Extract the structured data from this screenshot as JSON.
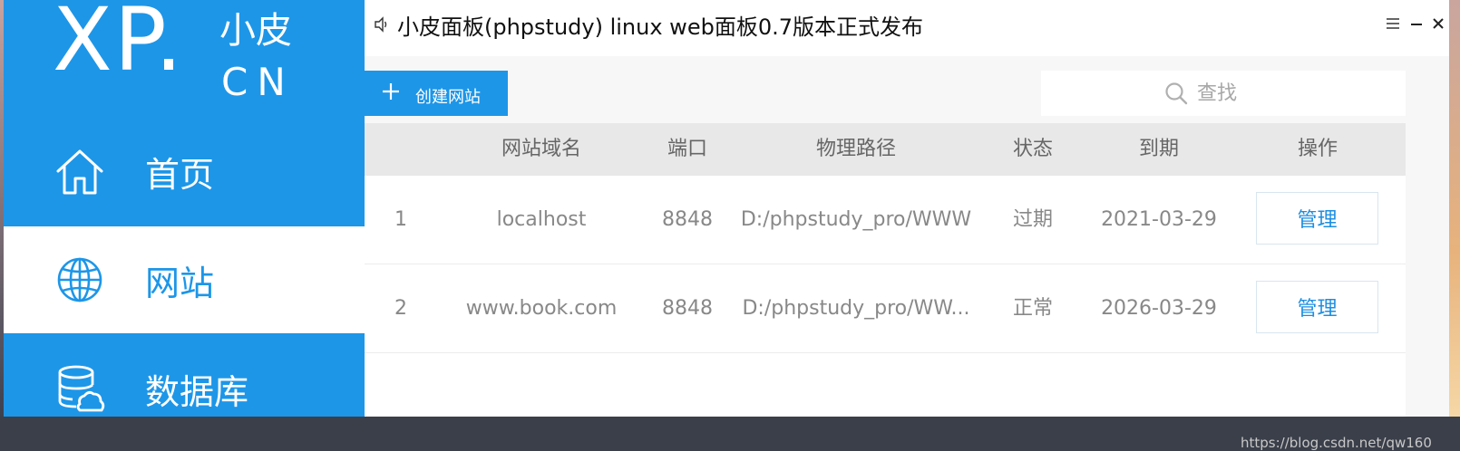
{
  "logo": {
    "mark": "XP.",
    "cn_top": "小皮",
    "cn_bottom": "CN"
  },
  "sidebar": {
    "items": [
      {
        "label": "首页",
        "icon": "home-icon",
        "active": false
      },
      {
        "label": "网站",
        "icon": "globe-icon",
        "active": true
      },
      {
        "label": "数据库",
        "icon": "database-icon",
        "active": false
      }
    ]
  },
  "window": {
    "title": "小皮面板(phpstudy) linux web面板0.7版本正式发布",
    "title_icon": "speaker-icon"
  },
  "toolbar": {
    "create_label": "创建网站",
    "search_placeholder": "查找"
  },
  "table": {
    "headers": [
      "",
      "网站域名",
      "端口",
      "物理路径",
      "状态",
      "到期",
      "操作"
    ],
    "rows": [
      {
        "index": "1",
        "domain": "localhost",
        "port": "8848",
        "path": "D:/phpstudy_pro/WWW",
        "status": "过期",
        "expiry": "2021-03-29",
        "action": "管理"
      },
      {
        "index": "2",
        "domain": "www.book.com",
        "port": "8848",
        "path": "D:/phpstudy_pro/WW...",
        "status": "正常",
        "expiry": "2026-03-29",
        "action": "管理"
      }
    ]
  },
  "watermark": "https://blog.csdn.net/qw160",
  "colors": {
    "accent": "#1d96e8",
    "header_bg": "#e8e8e8",
    "content_bg": "#f7f7f7"
  }
}
